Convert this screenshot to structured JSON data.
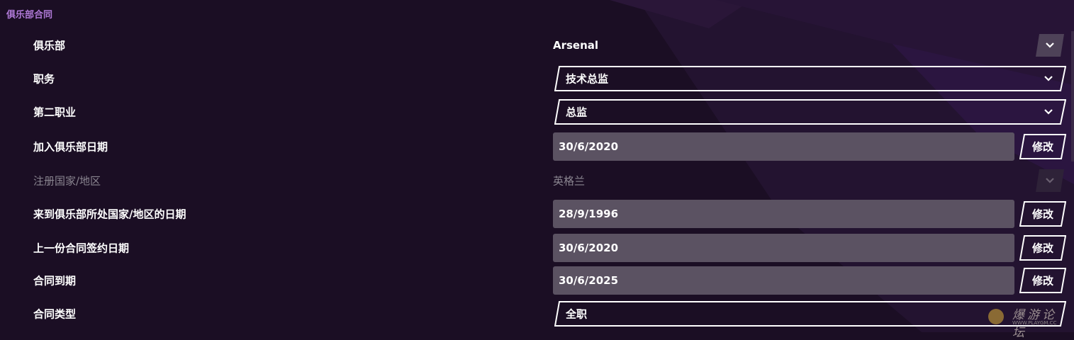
{
  "section_title": "俱乐部合同",
  "rows": {
    "club": {
      "label": "俱乐部",
      "value": "Arsenal"
    },
    "job": {
      "label": "职务",
      "value": "技术总监"
    },
    "second_job": {
      "label": "第二职业",
      "value": "总监"
    },
    "joined_club": {
      "label": "加入俱乐部日期",
      "value": "30/6/2020",
      "button": "修改"
    },
    "registered_nation": {
      "label": "注册国家/地区",
      "value": "英格兰"
    },
    "arrived_nation": {
      "label": "来到俱乐部所处国家/地区的日期",
      "value": "28/9/1996",
      "button": "修改"
    },
    "last_contract": {
      "label": "上一份合同签约日期",
      "value": "30/6/2020",
      "button": "修改"
    },
    "contract_expires": {
      "label": "合同到期",
      "value": "30/6/2025",
      "button": "修改"
    },
    "contract_type": {
      "label": "合同类型",
      "value": "全职"
    }
  },
  "watermark": {
    "text": "爆游论坛",
    "url": "WWW.PLAYGM.CC"
  },
  "colors": {
    "background": "#1b0e24",
    "accent_purple": "#b07ad8",
    "field_fill": "#5b5262",
    "disabled_text": "#8a8590"
  },
  "icons": [
    "chevron-down-icon",
    "watermark-logo-icon"
  ]
}
